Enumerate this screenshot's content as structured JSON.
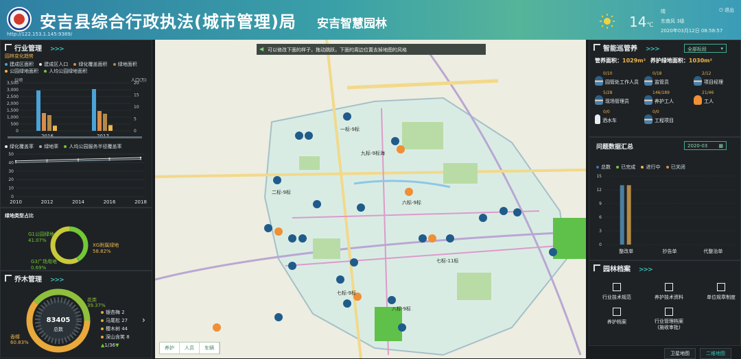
{
  "header": {
    "title": "安吉县综合行政执法(城市管理)局",
    "subtitle": "安吉智慧园林",
    "url": "http://122.153.1.145:9389/",
    "weather": {
      "temperature": "14",
      "unit": "℃",
      "condition": "晴",
      "wind": "东南风 3级",
      "datetime": "2020年03月12日 08:58:57"
    },
    "logout": "退出"
  },
  "industry": {
    "title": "行业管理",
    "arrows": ">>>",
    "sub_title": "园林变化趋势",
    "legend": [
      "建成区面积",
      "建成区人口",
      "绿化覆盖面积",
      "绿地面积",
      "公园绿地面积",
      "人均公园绿地面积"
    ],
    "axis_left_title": "公顷",
    "axis_right_title": "人口(万)",
    "sub_legend_2": [
      "绿化覆盖率",
      "绿地率",
      "人均公园服务半径覆盖率"
    ]
  },
  "green_type": {
    "title": "绿地类型占比",
    "g1": "G1公园绿地 41.07%",
    "g3": "G3广场用地 0.69%",
    "g2": "XG附属绿地 58.82%"
  },
  "tree": {
    "title": "乔木管理",
    "arrows": ">>>",
    "total": "83405",
    "total_label": "总数",
    "left_label_top": "香樟 60.83%",
    "right_label": "花类 39.37%",
    "list": [
      "银杏梅 2",
      "马尾松 27",
      "樱木树 44",
      "深山含笑 8"
    ],
    "pager": "1/36"
  },
  "map": {
    "tip": "可以修改下面的样子，拖动跳跃，下面的周边位置去掉地图的风格",
    "tabs": [
      "养护",
      "人员",
      "车辆"
    ],
    "labels": [
      "一标-9标",
      "九标-9标海",
      "六标-9标",
      "七标-9标",
      "八标-9标",
      "二标-9标",
      "七标-11标"
    ]
  },
  "smart": {
    "title": "智能巡管养",
    "arrows": ">>>",
    "select": "全部标段",
    "area_label": "管养面积：",
    "area_value": "1029m²",
    "green_label": "养护绿地面积：",
    "green_value": "1030m²",
    "staff": [
      {
        "label": "园管处工作人员",
        "count": "0/10"
      },
      {
        "label": "监管员",
        "count": "0/18"
      },
      {
        "label": "项目经理",
        "count": "2/12"
      },
      {
        "label": "现场管理员",
        "count": "5/28"
      },
      {
        "label": "养护工人",
        "count": "146/189"
      },
      {
        "label": "工人",
        "count": "21/46"
      },
      {
        "label": "洒水车",
        "count": "0/0"
      },
      {
        "label": "工程项目",
        "count": "0/0"
      }
    ]
  },
  "issues": {
    "title": "问题数据汇总",
    "date": "2020-03",
    "legend": [
      "总数",
      "已完成",
      "进行中",
      "已关闭"
    ],
    "categories": [
      "整改单",
      "抄告单",
      "代整治单"
    ]
  },
  "archives": {
    "title": "园林档案",
    "arrows": ">>>",
    "items": [
      "行业技术规范",
      "养护技术资料",
      "单位规章制度",
      "养护档案",
      "行业管理档案\n(施收审批)"
    ]
  },
  "bottom": {
    "satellite": "卫星地图",
    "map2d": "二维地图"
  },
  "chart_data": [
    {
      "type": "bar",
      "title": "园林变化趋势",
      "categories": [
        "2016",
        "2017"
      ],
      "series": [
        {
          "name": "建成区面积",
          "values": [
            2950,
            3050
          ]
        },
        {
          "name": "绿化覆盖面积",
          "values": [
            1300,
            1450
          ]
        },
        {
          "name": "绿地面积",
          "values": [
            1150,
            1250
          ]
        },
        {
          "name": "公园绿地面积",
          "values": [
            380,
            420
          ]
        }
      ],
      "ylim": [
        0,
        3500
      ],
      "ylabel": "公顷",
      "y2label": "人口(万)",
      "y2lim": [
        0,
        20
      ]
    },
    {
      "type": "line",
      "x": [
        2010,
        2012,
        2014,
        2016,
        2018
      ],
      "series": [
        {
          "name": "绿化覆盖率",
          "values": [
            42,
            43,
            44,
            45,
            46
          ]
        },
        {
          "name": "绿地率",
          "values": [
            40,
            41,
            42,
            43,
            44
          ]
        }
      ],
      "ylim": [
        0,
        50
      ]
    },
    {
      "type": "pie",
      "categories": [
        "G1公园绿地",
        "G3广场用地",
        "XG附属绿地"
      ],
      "values": [
        41.07,
        0.69,
        58.82
      ]
    },
    {
      "type": "bar",
      "title": "问题数据汇总",
      "categories": [
        "整改单",
        "抄告单",
        "代整治单"
      ],
      "series": [
        {
          "name": "总数",
          "values": [
            13,
            0,
            0
          ]
        },
        {
          "name": "已完成",
          "values": [
            13,
            0,
            0
          ]
        }
      ],
      "ylim": [
        0,
        15
      ]
    }
  ],
  "colors": {
    "accent": "#38c2b5",
    "orange": "#f0b74d",
    "green": "#73c836",
    "blue": "#3a72b7"
  }
}
